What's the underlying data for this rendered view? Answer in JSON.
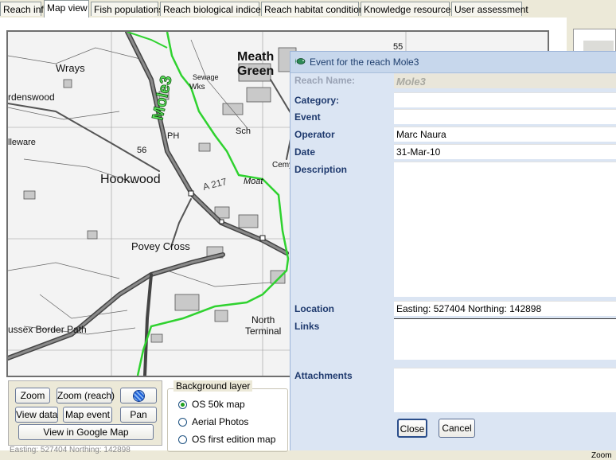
{
  "tabs": [
    "Reach info",
    "Map view",
    "Fish populations",
    "Reach biological indices",
    "Reach habitat condition",
    "Knowledge resources",
    "User assessment"
  ],
  "map": {
    "labels": {
      "mole3": "Mole3",
      "meath": "Meath",
      "green": "Green",
      "wrays": "Wrays",
      "rdenswood": "rdenswood",
      "leware": "lleware",
      "hookwood": "Hookwood",
      "moat": "Moat",
      "a217": "A 217",
      "povey": "Povey Cross",
      "north": "North",
      "terminal": "Terminal",
      "border": "ussex Border Path",
      "sewage": "Sewage",
      "wks": "Wks",
      "sch": "Sch",
      "ph": "PH",
      "n56": "56",
      "n55": "55",
      "cemy": "Cemy"
    }
  },
  "controls": {
    "zoom": "Zoom",
    "zoom_reach": "Zoom (reach)",
    "view_data": "View data",
    "map_event": "Map event",
    "pan": "Pan",
    "google": "View in Google Map",
    "status": "Easting: 527404 Northing: 142898"
  },
  "background_layer": {
    "legend": "Background layer",
    "options": [
      "OS 50k map",
      "Aerial Photos",
      "OS first edition map"
    ],
    "selected": "OS 50k map"
  },
  "right": {
    "zoom_label": "Zoom"
  },
  "dialog": {
    "title": "Event for the reach Mole3",
    "labels": {
      "reach_name": "Reach Name:",
      "category": "Category:",
      "event": "Event",
      "operator": "Operator",
      "date": "Date",
      "description": "Description",
      "location": "Location",
      "links": "Links",
      "attachments": "Attachments"
    },
    "values": {
      "reach_name": "Mole3",
      "category": "",
      "event": "",
      "operator": "Marc Naura",
      "date": "31-Mar-10",
      "description": "",
      "location": "Easting: 527404 Northing: 142898",
      "links": "",
      "attachments": ""
    },
    "close": "Close",
    "cancel": "Cancel"
  }
}
